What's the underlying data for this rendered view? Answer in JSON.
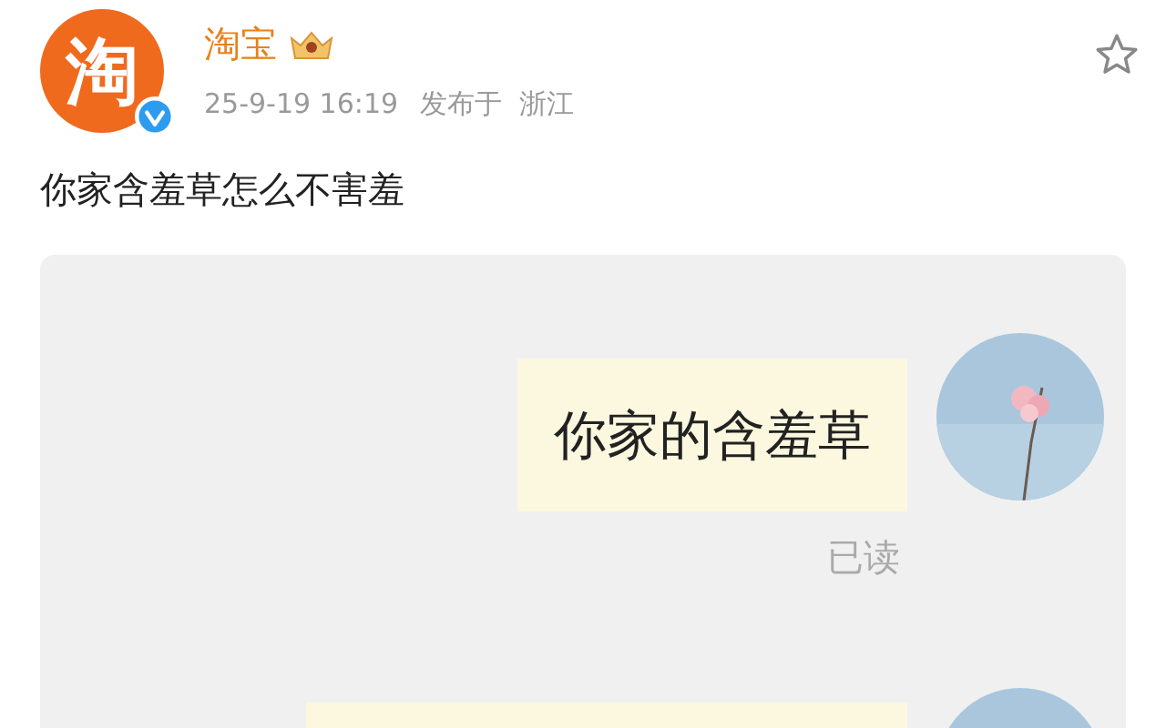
{
  "post": {
    "author": {
      "name": "淘宝",
      "logo_text": "淘",
      "verified": true,
      "crown_badge": true
    },
    "timestamp": "25-9-19 16:19",
    "location": "发布于  浙江",
    "favorited": false,
    "text": "你家含羞草怎么不害羞"
  },
  "screenshot": {
    "messages": [
      {
        "kind": "text",
        "text": "你家的含羞草",
        "status": "已读"
      },
      {
        "kind": "cut"
      }
    ]
  }
}
